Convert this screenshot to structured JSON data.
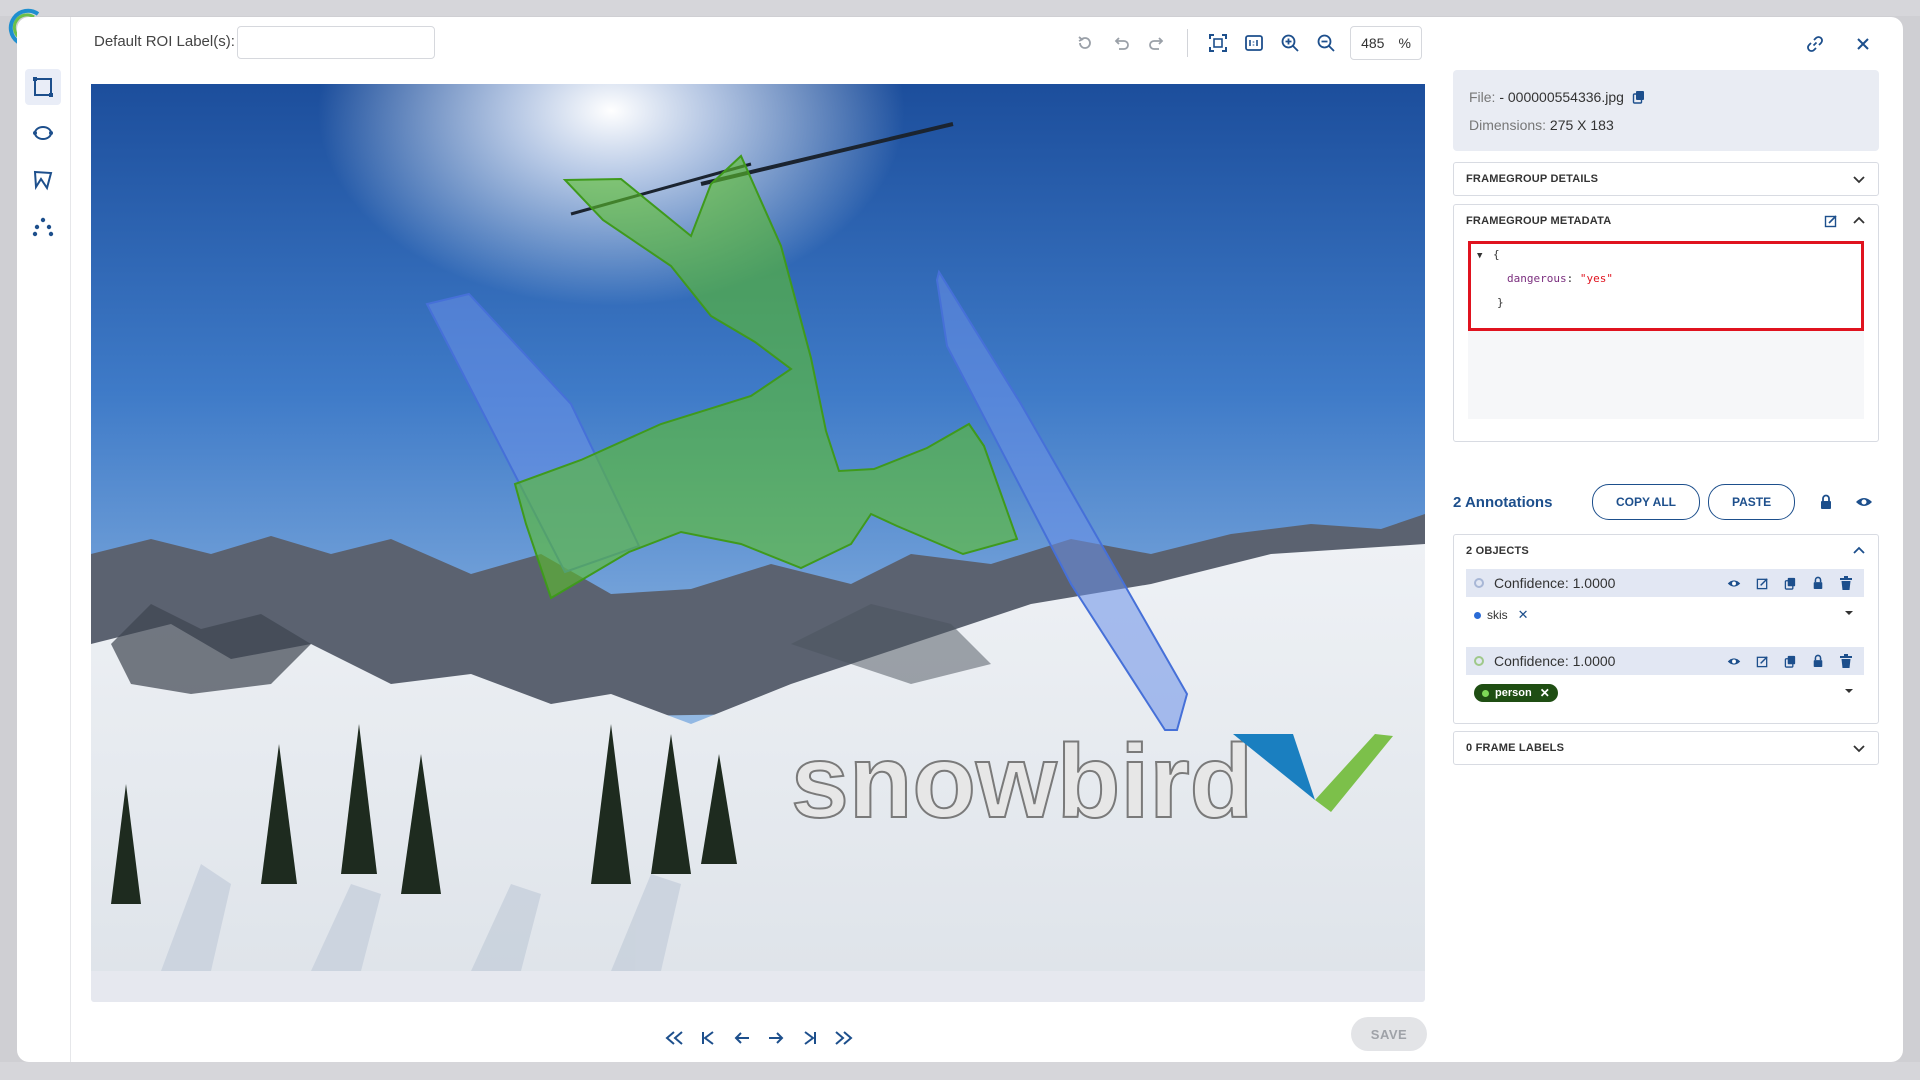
{
  "icons": {
    "app_logo": "app-logo-icon",
    "tools": [
      "rectangle-tool-icon",
      "ellipse-tool-icon",
      "polygon-tool-icon",
      "keypoint-tool-icon"
    ],
    "toolbar": [
      "reset-icon",
      "undo-icon",
      "redo-icon",
      "fit-screen-icon",
      "actual-size-icon",
      "zoom-in-icon",
      "zoom-out-icon"
    ],
    "top_right": [
      "link-icon",
      "close-icon"
    ],
    "nav": [
      "fast-backward-icon",
      "first-icon",
      "previous-icon",
      "next-icon",
      "last-icon",
      "fast-forward-icon"
    ]
  },
  "header": {
    "roi_label": "Default ROI Label(s):",
    "roi_value": "",
    "zoom_value": "485",
    "zoom_unit": "%"
  },
  "file": {
    "file_label": "File:",
    "file_name": "- 000000554336.jpg",
    "dimensions_label": "Dimensions:",
    "dimensions_value": "275 X 183"
  },
  "sections": {
    "details_title": "FRAMEGROUP DETAILS",
    "metadata_title": "FRAMEGROUP METADATA",
    "objects_title": "2 OBJECTS",
    "frame_labels_title": "0 FRAME LABELS"
  },
  "metadata_json": {
    "open_brace": "{",
    "key": "dangerous",
    "value": "\"yes\"",
    "close_brace": "}"
  },
  "annotations": {
    "count_text": "2 Annotations",
    "copy_all": "COPY ALL",
    "paste": "PASTE"
  },
  "objects": [
    {
      "confidence": "Confidence: 1.0000",
      "label": "skis",
      "color": "#2a6bd6"
    },
    {
      "confidence": "Confidence: 1.0000",
      "label": "person",
      "color": "#1f4e13"
    }
  ],
  "image": {
    "watermark_text": "snowbird"
  },
  "footer": {
    "save_label": "SAVE"
  },
  "colors": {
    "accent": "#1d4f8c",
    "highlight_border": "#e0131f",
    "person_mask": "#5cbf2a",
    "skis_mask": "#6a8fe8"
  }
}
